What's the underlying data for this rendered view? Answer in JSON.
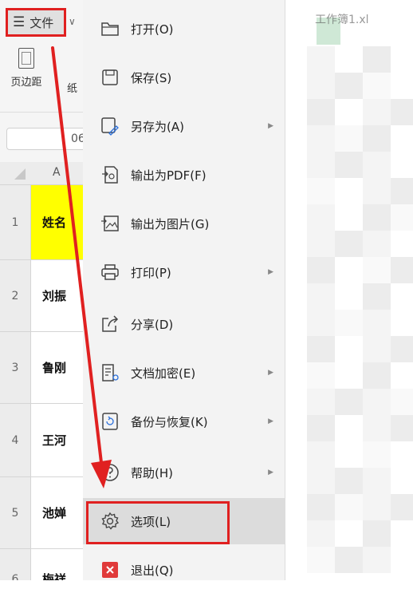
{
  "toolbar": {
    "file_label": "文件",
    "margin_label": "页边距",
    "paper_label": "纸",
    "cell_ref_value": "06"
  },
  "sheet": {
    "column_a": "A",
    "rows": [
      {
        "num": "1",
        "value": "姓名"
      },
      {
        "num": "2",
        "value": "刘振"
      },
      {
        "num": "3",
        "value": "鲁刚"
      },
      {
        "num": "4",
        "value": "王河"
      },
      {
        "num": "5",
        "value": "池婵"
      },
      {
        "num": "6",
        "value": "梅祥"
      }
    ]
  },
  "menu": {
    "items": [
      {
        "label": "打开(O)",
        "icon": "folder-icon",
        "submenu": false
      },
      {
        "label": "保存(S)",
        "icon": "save-icon",
        "submenu": false
      },
      {
        "label": "另存为(A)",
        "icon": "save-as-icon",
        "submenu": true
      },
      {
        "label": "输出为PDF(F)",
        "icon": "pdf-icon",
        "submenu": false
      },
      {
        "label": "输出为图片(G)",
        "icon": "image-export-icon",
        "submenu": false
      },
      {
        "label": "打印(P)",
        "icon": "printer-icon",
        "submenu": true
      },
      {
        "label": "分享(D)",
        "icon": "share-icon",
        "submenu": false
      },
      {
        "label": "文档加密(E)",
        "icon": "lock-document-icon",
        "submenu": true
      },
      {
        "label": "备份与恢复(K)",
        "icon": "backup-icon",
        "submenu": true
      },
      {
        "label": "帮助(H)",
        "icon": "help-icon",
        "submenu": true
      },
      {
        "label": "选项(L)",
        "icon": "gear-icon",
        "submenu": false
      },
      {
        "label": "退出(Q)",
        "icon": "exit-icon",
        "submenu": false
      }
    ]
  },
  "right_pane": {
    "tab_title": "工作簿1.xl"
  },
  "colors": {
    "highlight_red": "#e02020",
    "header_yellow": "#ffff00",
    "menu_bg": "#f3f3f3",
    "selected_bg": "#dcdcdc"
  }
}
